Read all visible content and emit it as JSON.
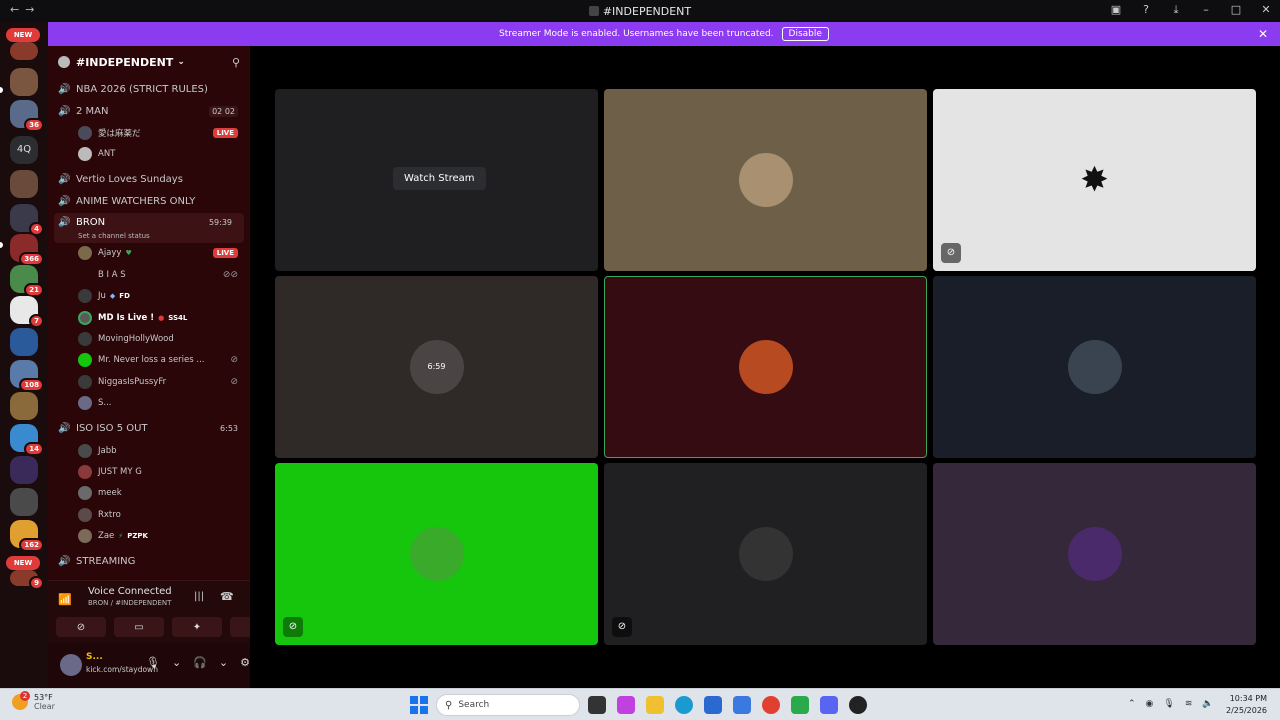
{
  "window": {
    "title": "#INDEPENDENT",
    "nav_back": "←",
    "nav_forward": "→"
  },
  "banner": {
    "text": "Streamer Mode is enabled. Usernames have been truncated.",
    "button": "Disable"
  },
  "server_rail": {
    "new_top": "NEW",
    "new_bottom": "NEW",
    "text_server": "4Q",
    "badges": [
      "36",
      "4",
      "366",
      "21",
      "7",
      "108",
      "14",
      "162",
      "9"
    ]
  },
  "guild": {
    "name": "#INDEPENDENT"
  },
  "channels": {
    "nba": "NBA 2026 (STRICT RULES)",
    "two_man": "2 MAN",
    "two_man_count": "02 02",
    "two_man_members": [
      {
        "name": "愛は麻薬だ",
        "badge": "LIVE"
      },
      {
        "name": "ANT"
      }
    ],
    "vertio": "Vertio Loves Sundays",
    "anime": "ANIME WATCHERS ONLY",
    "bron": "BRON",
    "bron_timer": "59:39",
    "bron_status": "Set a channel status",
    "bron_members": [
      {
        "name": "Ajayy",
        "badge": "LIVE"
      },
      {
        "name": "B I A S"
      },
      {
        "name": "Ju",
        "tag": "FD"
      },
      {
        "name": "MD Is Live !",
        "tag": "SS4L"
      },
      {
        "name": "MovingHollyWood"
      },
      {
        "name": "Mr. Never loss a series ..."
      },
      {
        "name": "NiggasIsPussyFr"
      },
      {
        "name": "S..."
      }
    ],
    "iso": "ISO ISO 5 OUT",
    "iso_timer": "6:53",
    "iso_members": [
      {
        "name": "Jabb"
      },
      {
        "name": "JUST MY G"
      },
      {
        "name": "meek"
      },
      {
        "name": "Rxtro"
      },
      {
        "name": "Zae",
        "tag": "PZPK"
      }
    ],
    "streaming": "STREAMING"
  },
  "voice": {
    "title": "Voice Connected",
    "subtitle": "BRON / #INDEPENDENT"
  },
  "user": {
    "name": "S...",
    "status": "kick.com/staydown"
  },
  "stage": {
    "watch_stream": "Watch Stream",
    "tile_overlay": "6:59"
  },
  "taskbar": {
    "temp": "53°F",
    "condition": "Clear",
    "weather_badge": "2",
    "search": "Search",
    "time": "10:34 PM",
    "date": "2/25/2026"
  },
  "colors": {
    "banner": "#8c3cf0",
    "sidebar": "#2a0608",
    "live": "#e03b3b",
    "speaking_border": "#3ba55c",
    "green_tile": "#16c60c"
  }
}
